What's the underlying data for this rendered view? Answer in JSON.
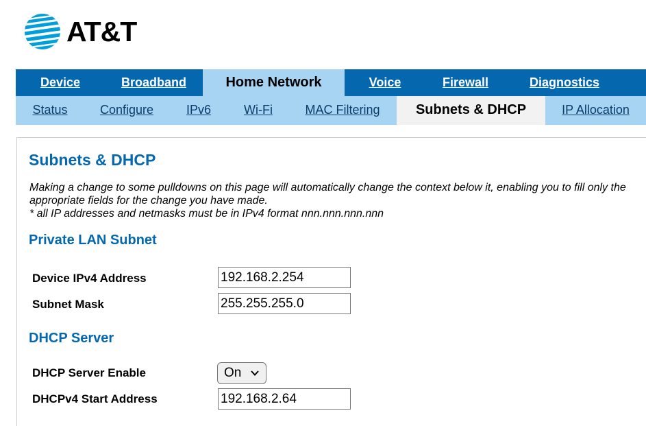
{
  "brand": {
    "name": "AT&T",
    "logo_icon": "att-globe-icon",
    "primary_color": "#0568ae",
    "secondary_color": "#a6d4f2"
  },
  "nav": {
    "top": [
      {
        "label": "Device",
        "active": false
      },
      {
        "label": "Broadband",
        "active": false
      },
      {
        "label": "Home Network",
        "active": true
      },
      {
        "label": "Voice",
        "active": false
      },
      {
        "label": "Firewall",
        "active": false
      },
      {
        "label": "Diagnostics",
        "active": false
      }
    ],
    "sub": [
      {
        "label": "Status",
        "active": false
      },
      {
        "label": "Configure",
        "active": false
      },
      {
        "label": "IPv6",
        "active": false
      },
      {
        "label": "Wi-Fi",
        "active": false
      },
      {
        "label": "MAC Filtering",
        "active": false
      },
      {
        "label": "Subnets & DHCP",
        "active": true
      },
      {
        "label": "IP Allocation",
        "active": false
      }
    ]
  },
  "page": {
    "title": "Subnets & DHCP",
    "intro": "Making a change to some pulldowns on this page will automatically change the context below it, enabling you to fill only the appropriate fields for the change you have made.",
    "note": "* all IP addresses and netmasks must be in IPv4 format nnn.nnn.nnn.nnn"
  },
  "private_lan": {
    "title": "Private LAN Subnet",
    "device_ipv4_label": "Device IPv4 Address",
    "device_ipv4_value": "192.168.2.254",
    "subnet_mask_label": "Subnet Mask",
    "subnet_mask_value": "255.255.255.0"
  },
  "dhcp": {
    "title": "DHCP Server",
    "enable_label": "DHCP Server Enable",
    "enable_value": "On",
    "start_label": "DHCPv4 Start Address",
    "start_value": "192.168.2.64"
  }
}
